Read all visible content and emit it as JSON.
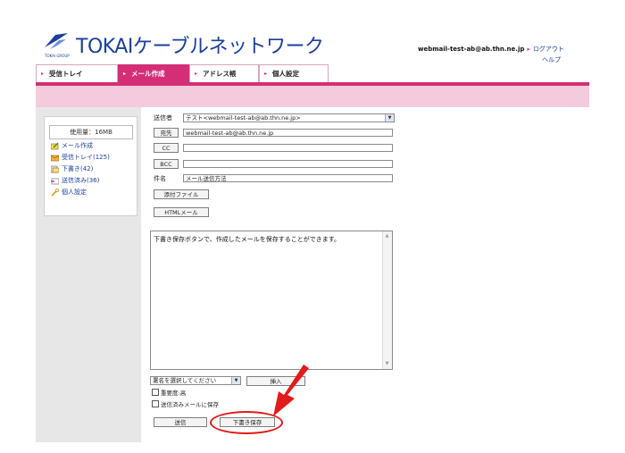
{
  "header": {
    "brand_name": "TOKAIケーブルネットワーク",
    "group_label": "TOKAI GROUP",
    "account_email": "webmail-test-ab@ab.thn.ne.jp",
    "logout_label": "ログアウト",
    "help_label": "ヘルプ"
  },
  "tabs": [
    {
      "label": "受信トレイ",
      "active": false
    },
    {
      "label": "メール作成",
      "active": true
    },
    {
      "label": "アドレス帳",
      "active": false
    },
    {
      "label": "個人設定",
      "active": false
    }
  ],
  "sidebar": {
    "usage": "使用量：16MB",
    "items": [
      {
        "label": "メール作成",
        "icon": "compose-icon"
      },
      {
        "label": "受信トレイ(125)",
        "icon": "inbox-icon"
      },
      {
        "label": "下書き(42)",
        "icon": "drafts-icon"
      },
      {
        "label": "送信済み(36)",
        "icon": "sent-icon"
      },
      {
        "label": "個人設定",
        "icon": "settings-icon"
      }
    ]
  },
  "compose": {
    "sender_label": "送信者",
    "sender_value": "テスト<webmail-test-ab@ab.thn.ne.jp>",
    "to_button": "宛先",
    "to_value": "webmail-test-ab@ab.thn.ne.jp",
    "cc_button": "CC",
    "cc_value": "",
    "bcc_button": "BCC",
    "bcc_value": "",
    "subject_label": "件名",
    "subject_value": "メール送信方法",
    "attach_button": "添付ファイル",
    "html_button": "HTMLメール",
    "body_text": "下書き保存ボタンで、作成したメールを保存することができます。",
    "signature_placeholder": "署名を選択してください",
    "signature_insert_button": "挿入",
    "priority_label": "重要度:高",
    "save_sent_label": "送信済みメールに保存",
    "send_button": "送信",
    "save_draft_button": "下書き保存"
  },
  "colors": {
    "accent_pink": "#d42e76",
    "band_pink": "#f4cbdc",
    "brand_blue": "#1b3f9a",
    "annotation_red": "#e21a1a"
  }
}
